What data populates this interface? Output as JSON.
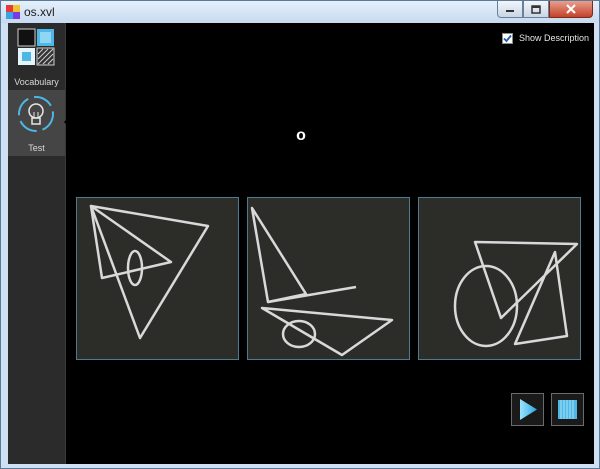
{
  "window": {
    "title": "os.xvl"
  },
  "sidebar": {
    "items": [
      {
        "label": "Vocabulary",
        "icon": "vocabulary-grid-icon"
      },
      {
        "label": "Test",
        "icon": "lightbulb-icon",
        "selected": true
      }
    ]
  },
  "main": {
    "show_description": {
      "label": "Show Description",
      "checked": true
    },
    "current_word": "o",
    "choices": [
      {
        "name": "choice-1"
      },
      {
        "name": "choice-2"
      },
      {
        "name": "choice-3"
      }
    ],
    "controls": [
      {
        "icon": "play-icon"
      },
      {
        "icon": "stop-icon"
      }
    ]
  },
  "colors": {
    "accent": "#4fb7e6",
    "tile_background": "#2c2c29",
    "tile_border": "#4e7b93",
    "stroke": "#d9d9d9"
  }
}
